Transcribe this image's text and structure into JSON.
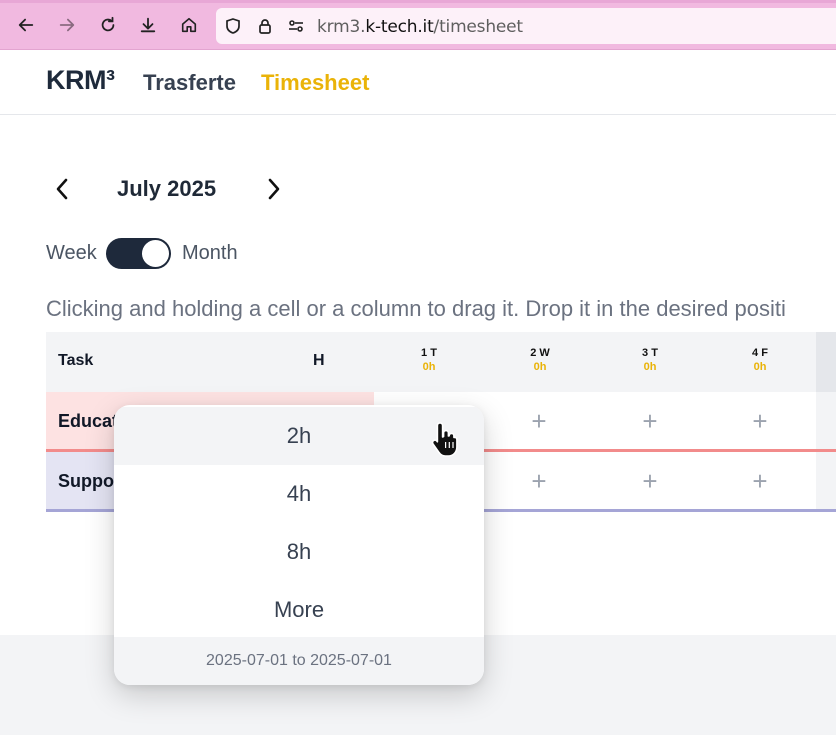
{
  "browser": {
    "url_prefix": "krm3.",
    "url_host": "k-tech.it",
    "url_path": "/timesheet",
    "icons": [
      "back-arrow-icon",
      "forward-arrow-icon",
      "reload-icon",
      "download-icon",
      "home-icon",
      "shield-icon",
      "lock-icon",
      "permissions-icon"
    ]
  },
  "header": {
    "logo": "KRM³",
    "nav": [
      {
        "label": "Trasferte",
        "active": false
      },
      {
        "label": "Timesheet",
        "active": true
      }
    ],
    "accent_color": "#eab308"
  },
  "calendar": {
    "month_label": "July 2025",
    "toggle_left": "Week",
    "toggle_right": "Month",
    "toggle_state": "Month"
  },
  "hint": "Clicking and holding a cell or a column to drag it. Drop it in the desired positi",
  "grid": {
    "col_task": "Task",
    "col_hours": "H",
    "days": [
      {
        "label": "1 T",
        "hours": "0h"
      },
      {
        "label": "2 W",
        "hours": "0h"
      },
      {
        "label": "3 T",
        "hours": "0h"
      },
      {
        "label": "4 F",
        "hours": "0h"
      }
    ],
    "rows": [
      {
        "task": "Educat",
        "color": "#fde2e2",
        "line_color": "#f28b8b"
      },
      {
        "task": "Suppo",
        "color": "#e4e4f3",
        "line_color": "#a5a5d6"
      }
    ],
    "add_symbol": "+"
  },
  "popup": {
    "options": [
      "2h",
      "4h",
      "8h",
      "More"
    ],
    "hovered": "2h",
    "date_range": "2025-07-01 to 2025-07-01"
  }
}
